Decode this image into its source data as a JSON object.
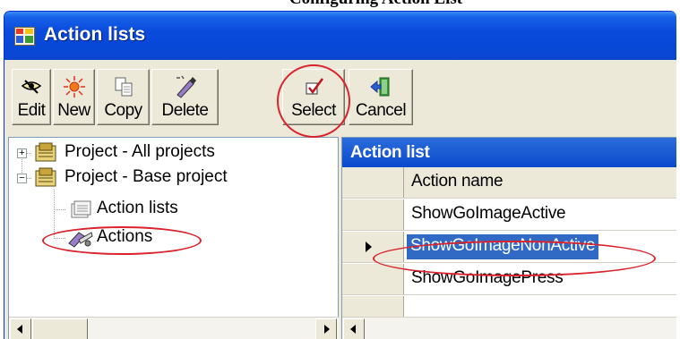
{
  "clipped_heading": "Configuring Action List",
  "window": {
    "title": "Action lists"
  },
  "toolbar": {
    "buttons": [
      {
        "label": "Edit",
        "icon": "edit-icon"
      },
      {
        "label": "New",
        "icon": "new-icon"
      },
      {
        "label": "Copy",
        "icon": "copy-icon"
      },
      {
        "label": "Delete",
        "icon": "delete-icon"
      },
      {
        "label": "Select",
        "icon": "select-icon"
      },
      {
        "label": "Cancel",
        "icon": "cancel-icon"
      }
    ]
  },
  "tree": {
    "items": [
      {
        "label": "Project - All projects",
        "expander": "+"
      },
      {
        "label": "Project - Base project",
        "expander": "−"
      },
      {
        "label": "Action lists"
      },
      {
        "label": "Actions"
      }
    ]
  },
  "grid": {
    "caption": "Action list",
    "column_header": "Action name",
    "rows": [
      "ShowGoImageActive",
      "ShowGoImageNonActive",
      "ShowGoImagePress"
    ]
  },
  "colors": {
    "titlebar": "#0a4bdc",
    "selection": "#316ac5",
    "annotation": "#d9232d"
  }
}
